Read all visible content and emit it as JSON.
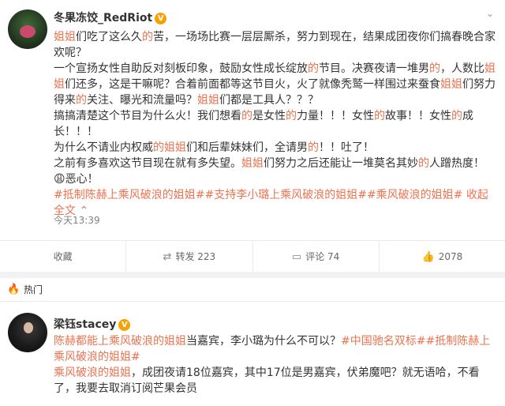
{
  "post1": {
    "username": "冬果冻饺_RedRiot",
    "para1": [
      {
        "t": "姐姐",
        "hl": true
      },
      {
        "t": "们吃了这么久",
        "hl": false
      },
      {
        "t": "的",
        "hl": true
      },
      {
        "t": "苦，一场场比赛一层层厮杀，努力到现在，结果成团夜你们搞春晚合家欢呢？",
        "hl": false
      }
    ],
    "para2": [
      {
        "t": "一个宣扬女性自助反对刻板印象，鼓励女性成长绽放",
        "hl": false
      },
      {
        "t": "的",
        "hl": true
      },
      {
        "t": "节目。决赛夜请一堆男",
        "hl": false
      },
      {
        "t": "的",
        "hl": true
      },
      {
        "t": "，人数比",
        "hl": false
      },
      {
        "t": "姐姐",
        "hl": true
      },
      {
        "t": "们还多，这是干嘛呢？合着前面都等这节目火，火了就像秃鹫一样围过来蚕食",
        "hl": false
      },
      {
        "t": "姐姐",
        "hl": true
      },
      {
        "t": "们努力得来",
        "hl": false
      },
      {
        "t": "的",
        "hl": true
      },
      {
        "t": "关注、曝光和流量吗？",
        "hl": false
      },
      {
        "t": "姐姐",
        "hl": true
      },
      {
        "t": "们都是工具人？？？",
        "hl": false
      }
    ],
    "para3": [
      {
        "t": "搞搞清楚这个节目为什么火！我们想看",
        "hl": false
      },
      {
        "t": "的",
        "hl": true
      },
      {
        "t": "是女性",
        "hl": false
      },
      {
        "t": "的",
        "hl": true
      },
      {
        "t": "力量！！！女性",
        "hl": false
      },
      {
        "t": "的",
        "hl": true
      },
      {
        "t": "故事！！女性",
        "hl": false
      },
      {
        "t": "的",
        "hl": true
      },
      {
        "t": "成长！！！",
        "hl": false
      }
    ],
    "para4": [
      {
        "t": "为什么不请业内权威",
        "hl": false
      },
      {
        "t": "的姐姐",
        "hl": true
      },
      {
        "t": "们和后辈妹妹们，全请男",
        "hl": false
      },
      {
        "t": "的",
        "hl": true
      },
      {
        "t": "！！吐了！",
        "hl": false
      }
    ],
    "para5": [
      {
        "t": "之前有多喜欢这节目现在就有多失望。",
        "hl": false
      },
      {
        "t": "姐姐",
        "hl": true
      },
      {
        "t": "们努力之后还能让一堆莫名其妙",
        "hl": false
      },
      {
        "t": "的",
        "hl": true
      },
      {
        "t": "人蹭热度！",
        "hl": false
      },
      {
        "t": "😩",
        "hl": false
      },
      {
        "t": "恶心！",
        "hl": false
      }
    ],
    "tags": [
      "#抵制陈赫上乘风破浪的姐姐#",
      "#支持李小璐上乘风破浪的姐姐#",
      "#乘风破浪的姐姐#"
    ],
    "collapse_label": "收起全文",
    "collapse_icon": "chevron-up-icon",
    "time": "今天13:39",
    "actions": {
      "favorite": "收藏",
      "repost": "转发 223",
      "comment": "评论 74",
      "like": "2078"
    }
  },
  "hot_label": "热门",
  "post2": {
    "username": "梁钰stacey",
    "para1": [
      {
        "t": "陈赫都能",
        "hl": true
      },
      {
        "t": "上乘风破浪的姐姐",
        "hl": true
      },
      {
        "t": "当嘉宾，李小璐为什么不可以？",
        "hl": false
      },
      {
        "t": "#中国驰名双标#",
        "hl": true
      },
      {
        "t": "#抵制陈赫上乘风破浪的姐姐#",
        "hl": true
      }
    ],
    "para2": [
      {
        "t": "乘风破浪的姐姐",
        "hl": true
      },
      {
        "t": "，成团夜请18位嘉宾，其中17位是男嘉宾，伏弟魔吧？就无语哈，不看了，我要去取消订阅芒果会员",
        "hl": false
      }
    ]
  },
  "colors": {
    "highlight": "#eb7350",
    "badge": "#f8a100",
    "text": "#333333",
    "muted": "#808080",
    "separator": "#f2f2f5"
  }
}
